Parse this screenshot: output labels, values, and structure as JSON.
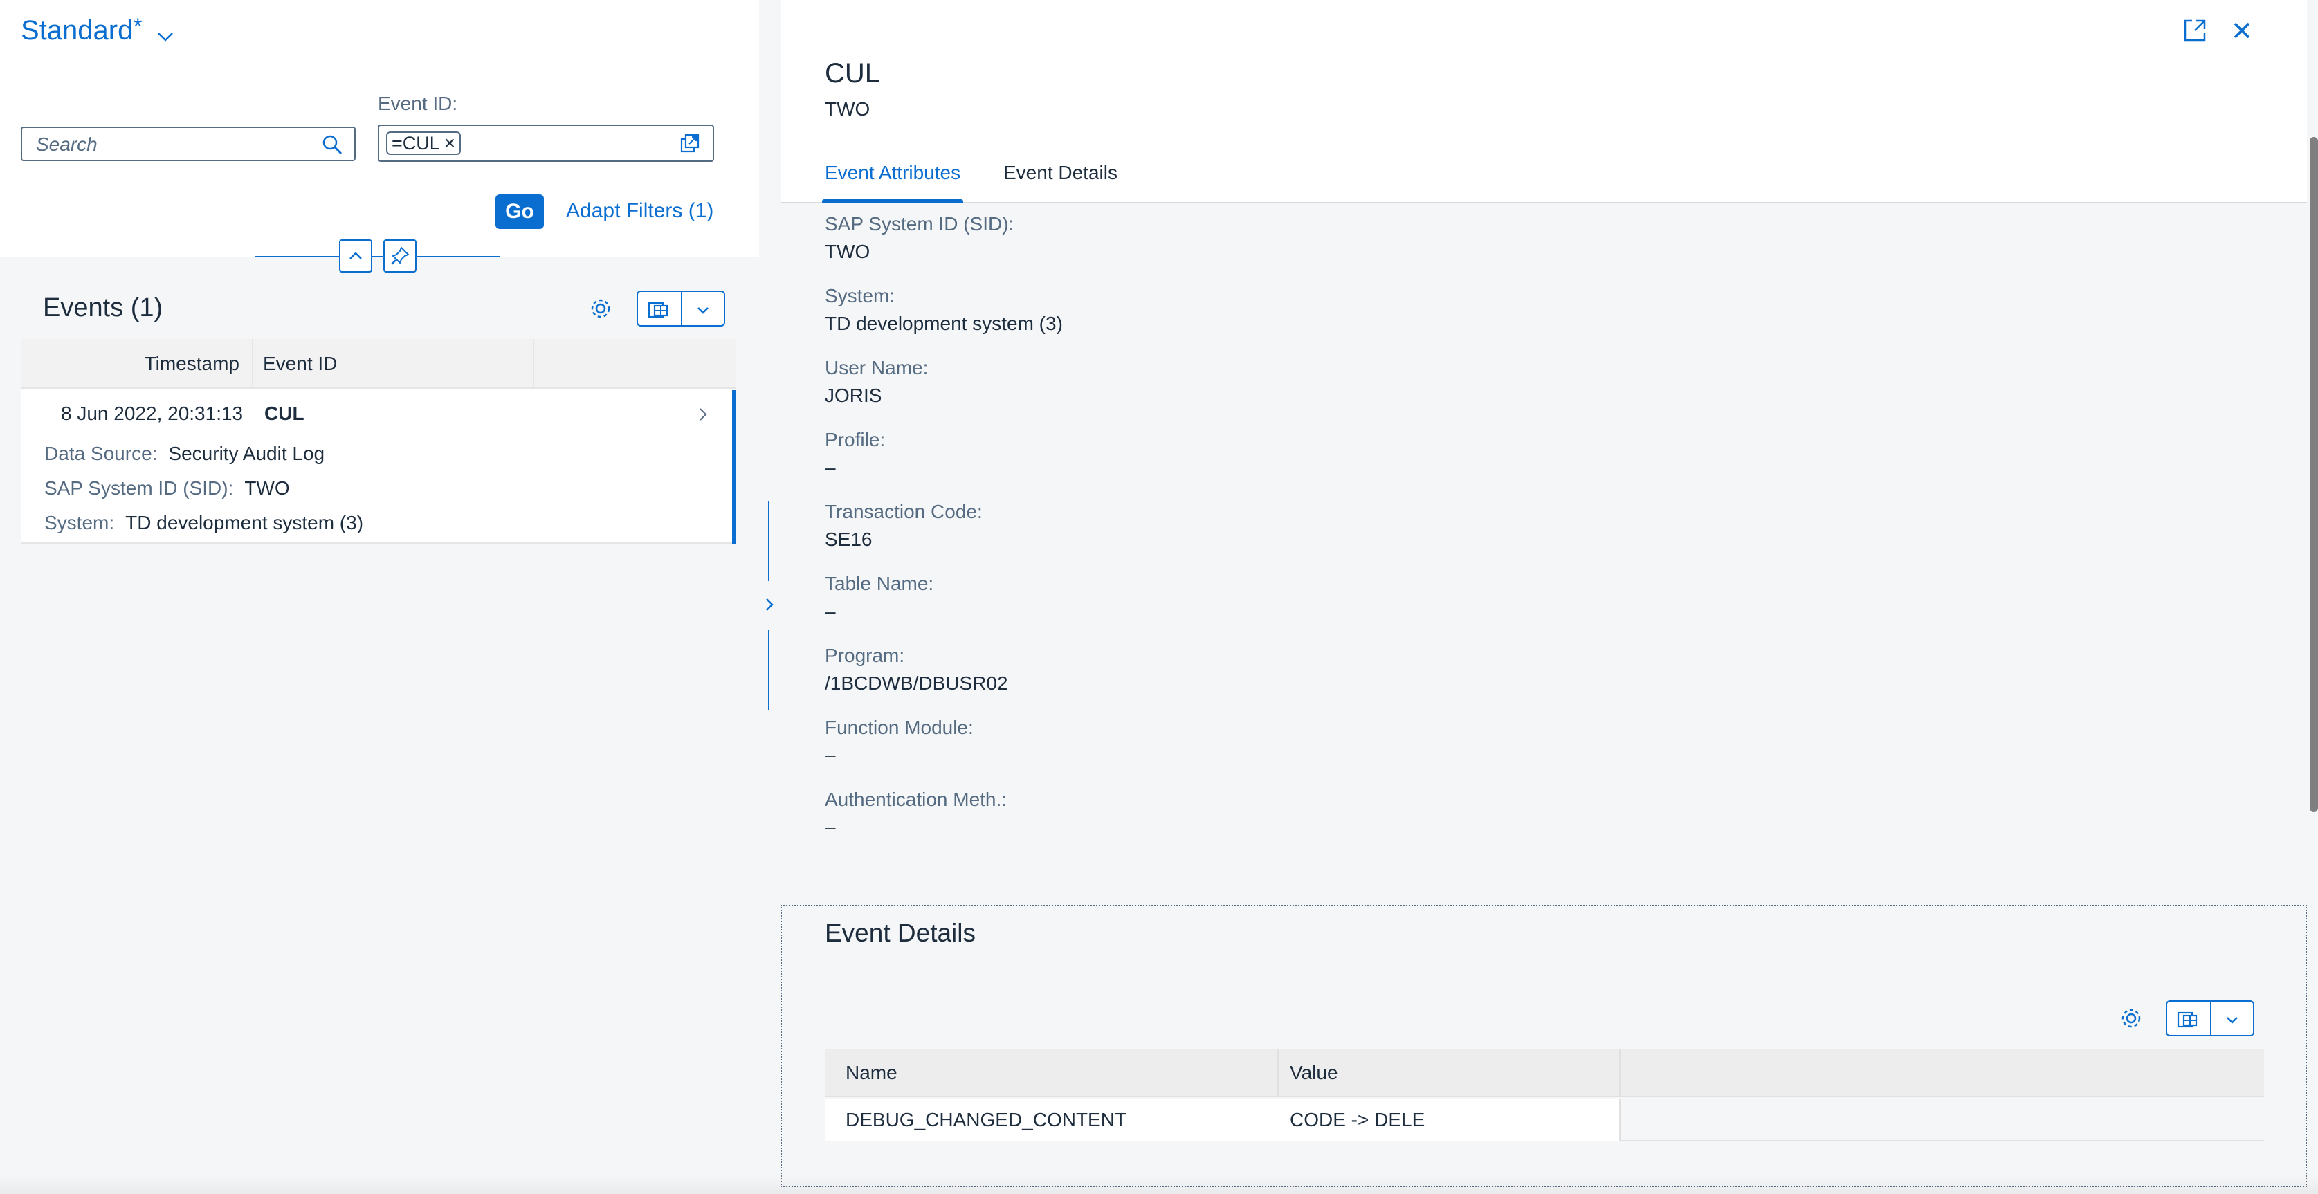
{
  "variant": {
    "title": "Standard",
    "asterisk": "*"
  },
  "filters": {
    "search_placeholder": "Search",
    "event_id_label": "Event ID:",
    "event_id_token": "=CUL",
    "go_label": "Go",
    "adapt_filters_label": "Adapt Filters (1)"
  },
  "events": {
    "title": "Events (1)",
    "columns": [
      "Timestamp",
      "Event ID"
    ],
    "rows": [
      {
        "timestamp": "8 Jun 2022, 20:31:13",
        "event_id": "CUL",
        "data_source_label": "Data Source:",
        "data_source": "Security Audit Log",
        "sid_label": "SAP System ID (SID):",
        "sid": "TWO",
        "system_label": "System:",
        "system": "TD development system (3)"
      }
    ]
  },
  "detail": {
    "title": "CUL",
    "subtitle": "TWO",
    "tabs": [
      "Event Attributes",
      "Event Details"
    ],
    "active_tab": "Event Attributes",
    "attributes": [
      {
        "label": "SAP System ID (SID):",
        "value": "TWO"
      },
      {
        "label": "System:",
        "value": "TD development system (3)"
      },
      {
        "label": "User Name:",
        "value": "JORIS"
      },
      {
        "label": "Profile:",
        "value": "–"
      },
      {
        "label": "Transaction Code:",
        "value": "SE16"
      },
      {
        "label": "Table Name:",
        "value": "–"
      },
      {
        "label": "Program:",
        "value": "/1BCDWB/DBUSR02"
      },
      {
        "label": "Function Module:",
        "value": "–"
      },
      {
        "label": "Authentication Meth.:",
        "value": "–"
      }
    ],
    "event_details": {
      "title": "Event Details",
      "columns": [
        "Name",
        "Value"
      ],
      "rows": [
        {
          "name": "DEBUG_CHANGED_CONTENT",
          "value": "CODE -> DELE"
        }
      ]
    }
  },
  "colors": {
    "accent": "#0a6ed1",
    "text": "#1d2d3e",
    "label": "#556b82",
    "background": "#f5f6f7"
  }
}
